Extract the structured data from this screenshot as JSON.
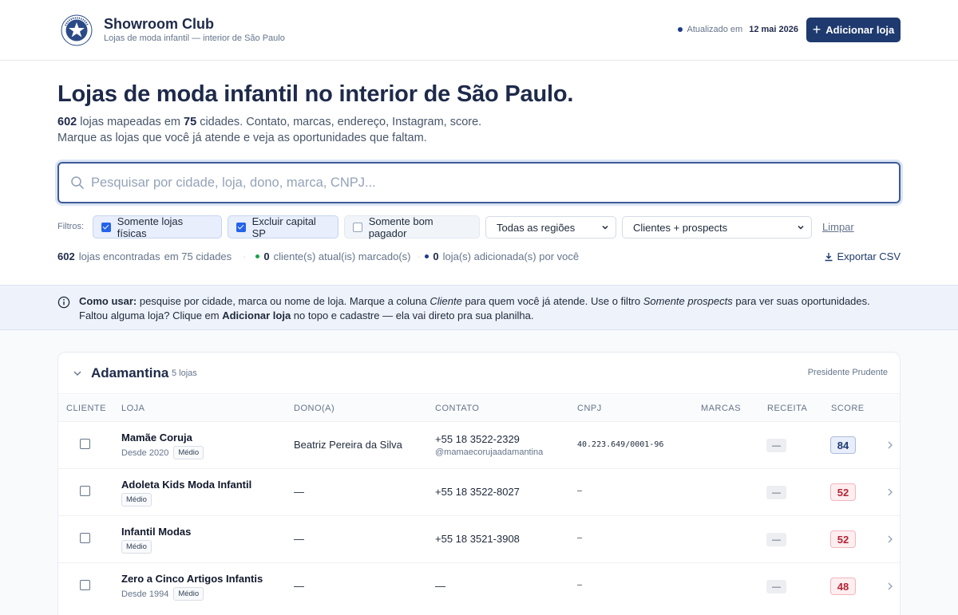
{
  "header": {
    "brand_title": "Showroom Club",
    "brand_subtitle": "Lojas de moda infantil — interior de São Paulo",
    "logo_text": "SHOW ROOM CLUB",
    "updated_label": "Atualizado em",
    "updated_date": "12 mai 2026",
    "add_button": "Adicionar loja"
  },
  "hero": {
    "title": "Lojas de moda infantil no interior de São Paulo.",
    "stores_count": "602",
    "line1_a": "lojas mapeadas em",
    "cities_count": "75",
    "line1_b": "cidades. Contato, marcas, endereço, Instagram, score.",
    "line2": "Marque as lojas que você já atende e veja as oportunidades que faltam."
  },
  "search": {
    "placeholder": "Pesquisar por cidade, loja, dono, marca, CNPJ..."
  },
  "filters": {
    "label": "Filtros:",
    "options": [
      {
        "label": "Somente lojas físicas",
        "checked": true
      },
      {
        "label": "Excluir capital SP",
        "checked": true
      },
      {
        "label": "Somente bom pagador",
        "checked": false
      }
    ],
    "region_select": "Todas as regiões",
    "client_select": "Clientes + prospects",
    "clear": "Limpar"
  },
  "results": {
    "found_count": "602",
    "found_text": "lojas encontradas",
    "in_cities": "em 75 cidades",
    "clients_count": "0",
    "clients_text": "cliente(s) atual(is) marcado(s)",
    "added_count": "0",
    "added_text": "loja(s) adicionada(s) por você",
    "export": "Exportar CSV",
    "colors": {
      "clients_dot": "#16a34a",
      "added_dot": "#1e3a8a"
    }
  },
  "info": {
    "b1": "Como usar:",
    "t1": " pesquise por cidade, marca ou nome de loja. Marque a coluna ",
    "i1": "Cliente",
    "t2": " para quem você já atende. Use o filtro ",
    "i2": "Somente prospects",
    "t3": " para ver suas oportunidades. Faltou alguma loja? Clique em ",
    "b2": "Adicionar loja",
    "t4": " no topo e cadastre — ela vai direto pra sua planilha."
  },
  "city_group": {
    "city": "Adamantina",
    "count": "5 lojas",
    "region": "Presidente Prudente",
    "columns": [
      "CLIENTE",
      "LOJA",
      "DONO(A)",
      "CONTATO",
      "CNPJ",
      "MARCAS",
      "RECEITA",
      "SCORE"
    ],
    "rows": [
      {
        "name": "Mamãe Coruja",
        "since": "Desde 2020",
        "size": "Médio",
        "owner": "Beatriz Pereira da Silva",
        "phone": "+55 18 3522-2329",
        "instagram": "@mamaecorujaadamantina",
        "cnpj": "40.223.649/0001-96",
        "receita": "—",
        "score": "84",
        "score_level": "high"
      },
      {
        "name": "Adoleta Kids Moda Infantil",
        "since": "",
        "size": "Médio",
        "owner": "—",
        "phone": "+55 18 3522-8027",
        "instagram": "",
        "cnpj": "–",
        "receita": "—",
        "score": "52",
        "score_level": "mid"
      },
      {
        "name": "Infantil Modas",
        "since": "",
        "size": "Médio",
        "owner": "—",
        "phone": "+55 18 3521-3908",
        "instagram": "",
        "cnpj": "–",
        "receita": "—",
        "score": "52",
        "score_level": "mid"
      },
      {
        "name": "Zero a Cinco Artigos Infantis",
        "since": "Desde 1994",
        "size": "Médio",
        "owner": "—",
        "phone": "—",
        "instagram": "",
        "cnpj": "–",
        "receita": "—",
        "score": "48",
        "score_level": "mid"
      }
    ]
  }
}
